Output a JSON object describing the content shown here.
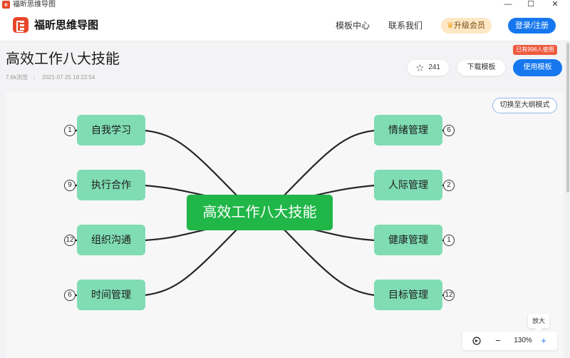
{
  "window": {
    "title": "福昕思维导图",
    "app_icon": "app-logo-icon",
    "controls": [
      "—",
      "☐",
      "✕"
    ]
  },
  "nav": {
    "brand": "福昕思维导图",
    "links": [
      "模板中心",
      "联系我们"
    ],
    "vip_label": "升级会员",
    "login_label": "登录/注册"
  },
  "header": {
    "title": "高效工作八大技能",
    "views": "7.6k浏览",
    "separator": "|",
    "datetime": "2021-07-25 18:22:54",
    "used_badge": "已有996人使用",
    "favorite_count": "241",
    "download_label": "下载模板",
    "use_label": "使用模板"
  },
  "mindmap": {
    "central": "高效工作八大技能",
    "left": [
      {
        "label": "自我学习",
        "badge": "1"
      },
      {
        "label": "执行合作",
        "badge": "9"
      },
      {
        "label": "组织沟通",
        "badge": "12"
      },
      {
        "label": "时间管理",
        "badge": "6"
      }
    ],
    "right": [
      {
        "label": "情绪管理",
        "badge": "6"
      },
      {
        "label": "人际管理",
        "badge": "2"
      },
      {
        "label": "健康管理",
        "badge": "1"
      },
      {
        "label": "目标管理",
        "badge": "12"
      }
    ]
  },
  "toolbar": {
    "outline_toggle": "切换至大纲模式",
    "zoom_minus": "−",
    "zoom_level": "130%",
    "zoom_plus": "+",
    "tooltip": "放大"
  },
  "colors": {
    "accent": "#1677ee",
    "brand": "#e8462b",
    "central_node": "#20b648",
    "branch_node": "#7fdcb3"
  }
}
